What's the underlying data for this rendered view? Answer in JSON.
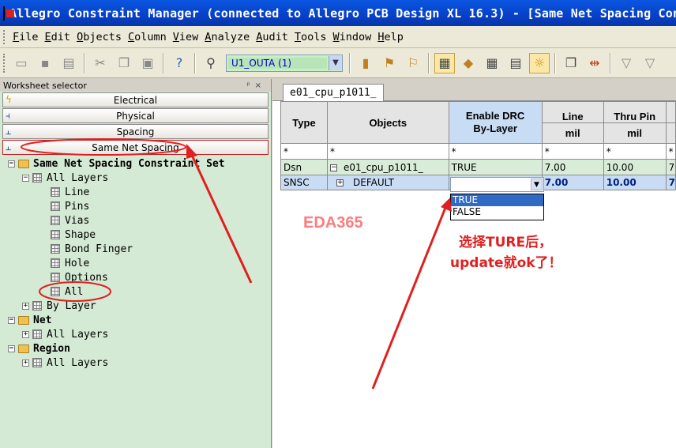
{
  "window": {
    "title": "Allegro Constraint Manager (connected to Allegro PCB Design XL 16.3) - [Same Net Spacing Constraint Set]"
  },
  "menubar": {
    "items": [
      "File",
      "Edit",
      "Objects",
      "Column",
      "View",
      "Analyze",
      "Audit",
      "Tools",
      "Window",
      "Help"
    ]
  },
  "toolbar": {
    "design_combo_value": "U1_OUTA (1)"
  },
  "worksheet_selector": {
    "title": "Worksheet selector",
    "pin_glyph": "ᵖ",
    "close_glyph": "×",
    "bars": [
      "Electrical",
      "Physical",
      "Spacing",
      "Same Net Spacing"
    ]
  },
  "tree": {
    "root": "Same Net Spacing Constraint Set",
    "all_layers": "All Layers",
    "children": [
      "Line",
      "Pins",
      "Vias",
      "Shape",
      "Bond Finger",
      "Hole",
      "Options",
      "All"
    ],
    "by_layer": "By Layer",
    "net": "Net",
    "net_all_layers": "All Layers",
    "region": "Region",
    "region_all_layers": "All Layers"
  },
  "worksheet": {
    "tab": "e01_cpu_p1011_",
    "columns": {
      "type": "Type",
      "objects": "Objects",
      "drc_line1": "Enable DRC",
      "drc_line2": "By-Layer",
      "line": "Line",
      "line_unit": "mil",
      "thru_pin": "Thru Pin",
      "thru_pin_unit": "mil",
      "filter": "*"
    },
    "rows": [
      {
        "type": "Dsn",
        "object": "e01_cpu_p1011_",
        "drc": "TRUE",
        "line": "7.00",
        "thru_pin": "10.00",
        "next": "7"
      },
      {
        "type": "SNSC",
        "object": "DEFAULT",
        "drc": "",
        "line": "7.00",
        "thru_pin": "10.00",
        "next": "7"
      }
    ],
    "dropdown_options": [
      "TRUE",
      "FALSE"
    ]
  },
  "annotations": {
    "watermark": "EDA365",
    "note_line1": "选择TURE后，",
    "note_line2": "update就ok了！",
    "color": "#e02020"
  }
}
